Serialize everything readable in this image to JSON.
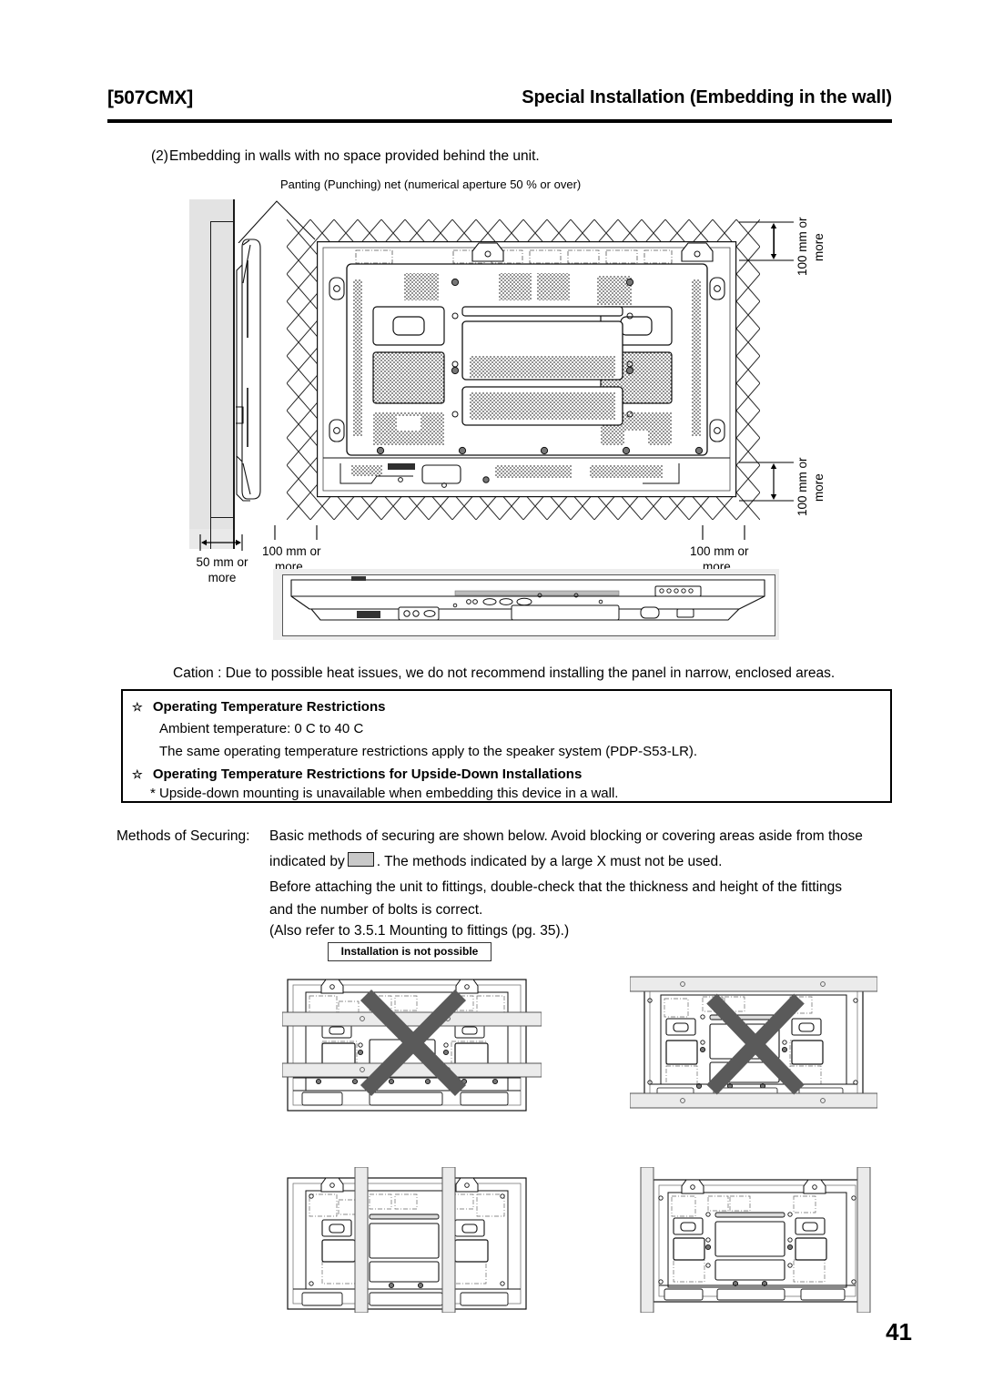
{
  "header": {
    "model": "[507CMX]",
    "section_title": "Special Installation (Embedding in the wall)"
  },
  "intro": {
    "number": "(2)",
    "text": "Embedding in walls with no space provided behind the unit."
  },
  "figure": {
    "net_caption": "Panting (Punching) net (numerical aperture 50 % or over)",
    "dim_top_right": "100 mm or\nmore",
    "dim_top_right_line1": "100 mm or",
    "dim_top_right_line2": "more",
    "dim_bottom_right_line1": "100 mm or",
    "dim_bottom_right_line2": "more",
    "dim_left_line1": "50 mm or",
    "dim_left_line2": "more",
    "dim_center_line1": "100 mm or",
    "dim_center_line2": "more",
    "dim_right_line1": "100 mm or",
    "dim_right_line2": "more"
  },
  "caution": {
    "text": "Cation : Due to possible heat issues, we do not recommend installing the panel in narrow, enclosed areas."
  },
  "temperature_box": {
    "star": "☆",
    "heading1": "Operating Temperature Restrictions",
    "line1": "Ambient temperature:  0  C  to 40  C",
    "line2": "The same operating temperature restrictions apply to the speaker system (PDP-S53-LR).",
    "heading2": "Operating Temperature Restrictions for Upside-Down Installations",
    "line3": "*  Upside-down mounting is unavailable when embedding this device in a wall."
  },
  "methods": {
    "label": "Methods of Securing:",
    "line1": "Basic methods of securing are shown below. Avoid blocking or covering areas aside from those",
    "line2_a": "indicated by",
    "line2_b": ". The methods indicated by a large  X   must not be used.",
    "line3": "Before attaching the unit to fittings, double-check that the thickness and height of the fittings",
    "line4": "and the number of bolts is correct.",
    "line5": "(Also refer to  3.5.1 Mounting to fittings  (pg. 35).)"
  },
  "diagrams": {
    "not_possible_label": "Installation is not possible",
    "items": [
      {
        "name": "horizontal-bars-inner",
        "bars": "horizontal-inner",
        "marked_x": true
      },
      {
        "name": "horizontal-bars-outer",
        "bars": "horizontal-outer",
        "marked_x": true
      },
      {
        "name": "vertical-bars-inner",
        "bars": "vertical-inner",
        "marked_x": false
      },
      {
        "name": "vertical-bars-outer",
        "bars": "vertical-outer",
        "marked_x": false
      }
    ]
  },
  "footer": {
    "page_number": "41"
  },
  "colors": {
    "ink": "#000000",
    "wall_gray": "#e3e3e3",
    "bar_gray": "#ebebeb",
    "x_gray": "#5a5a5a",
    "swatch_gray": "#c9c9c9",
    "line_gray": "#555555"
  }
}
